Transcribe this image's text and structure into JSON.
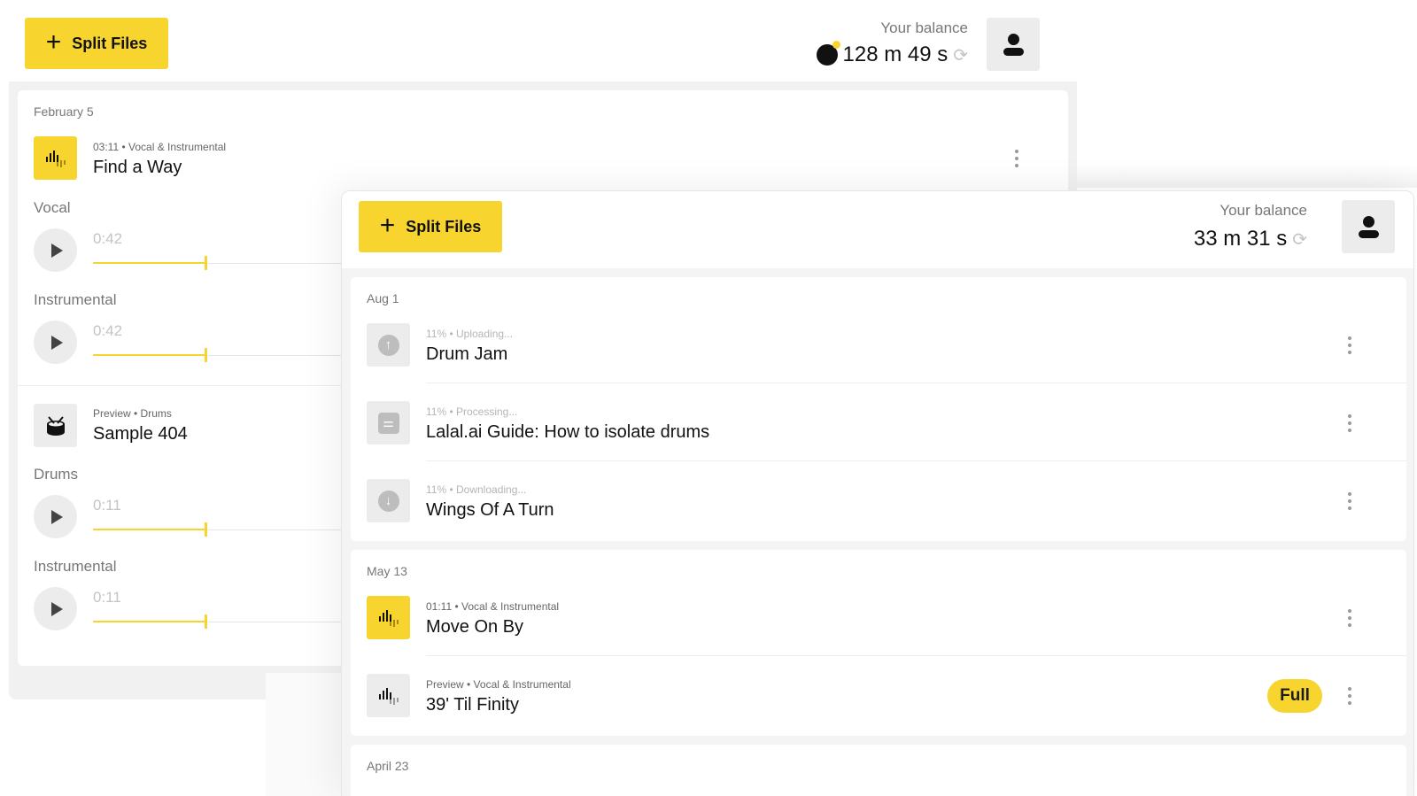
{
  "colors": {
    "accent": "#f8d52e",
    "panel": "#f1f1f1",
    "muted": "#777777"
  },
  "back_window": {
    "split_button": "Split Files",
    "balance_label": "Your balance",
    "balance_value": "128 m 49 s",
    "group_date": "February 5",
    "items": [
      {
        "meta": "03:11 • Vocal & Instrumental",
        "title": "Find a Way",
        "stems": [
          {
            "label": "Vocal",
            "time": "0:42"
          },
          {
            "label": "Instrumental",
            "time": "0:42"
          }
        ]
      },
      {
        "meta": "Preview • Drums",
        "title": "Sample 404",
        "stems": [
          {
            "label": "Drums",
            "time": "0:11"
          },
          {
            "label": "Instrumental",
            "time": "0:11"
          }
        ]
      }
    ]
  },
  "front_window": {
    "split_button": "Split Files",
    "balance_label": "Your balance",
    "balance_value": "33 m 31 s",
    "groups": [
      {
        "date": "Aug 1",
        "items": [
          {
            "meta": "11% • Uploading...",
            "title": "Drum Jam",
            "icon": "upload-icon"
          },
          {
            "meta": "11% • Processing...",
            "title": "Lalal.ai Guide: How to isolate drums",
            "icon": "sliders-icon"
          },
          {
            "meta": "11% • Downloading...",
            "title": "Wings Of A Turn",
            "icon": "download-icon"
          }
        ]
      },
      {
        "date": "May 13",
        "items": [
          {
            "meta": "01:11 • Vocal & Instrumental",
            "title": "Move On By",
            "icon": "waveform-icon"
          },
          {
            "meta": "Preview • Vocal & Instrumental",
            "title": "39' Til Finity",
            "icon": "waveform-icon",
            "badge": "Full"
          }
        ]
      },
      {
        "date": "April 23",
        "items": []
      }
    ]
  }
}
